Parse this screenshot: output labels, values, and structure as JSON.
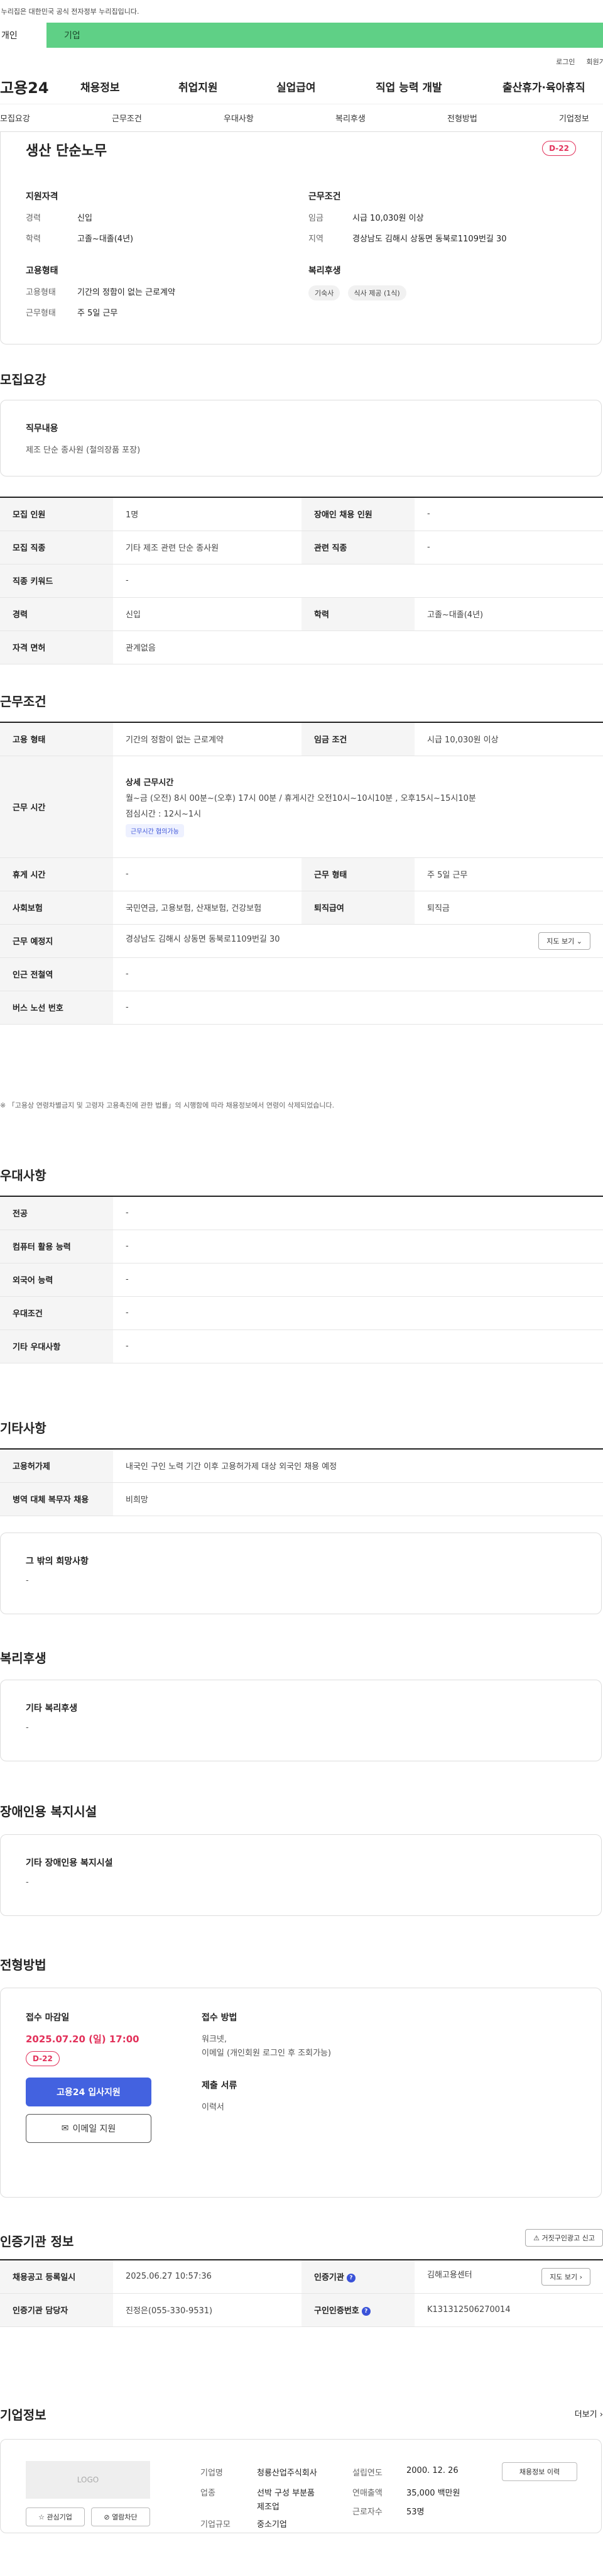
{
  "gov_notice": "이 누리집은 대한민국 공식 전자정부 누리집입니다.",
  "tabs": [
    "개인",
    "기업"
  ],
  "util": [
    "로그인",
    "회원가입"
  ],
  "logo": "고용24",
  "gnb": [
    "채용정보",
    "취업지원",
    "실업급여",
    "직업 능력 개발",
    "출산휴가·육아휴직"
  ],
  "anchor_nav": [
    "모집요강",
    "근무조건",
    "우대사항",
    "복리후생",
    "전형방법",
    "기업정보"
  ],
  "summary": {
    "title": "생산 단순노무",
    "dday": "D-22",
    "qual_title": "지원자격",
    "qual": [
      {
        "k": "경력",
        "v": "신입"
      },
      {
        "k": "학력",
        "v": "고졸~대졸(4년)"
      }
    ],
    "cond_title": "근무조건",
    "cond": [
      {
        "k": "임금",
        "v": "시급 10,030원 이상"
      },
      {
        "k": "지역",
        "v": "경상남도 김해시 상동면 동북로1109번길 30"
      }
    ],
    "emp_title": "고용형태",
    "emp": [
      {
        "k": "고용형태",
        "v": "기간의 정함이 없는 근로계약"
      },
      {
        "k": "근무형태",
        "v": "주 5일 근무"
      }
    ],
    "welfare_title": "복리후생",
    "welfare_chips": [
      "기숙사",
      "식사 제공 (1식)"
    ]
  },
  "recruit": {
    "title": "모집요강",
    "job_box_title": "직무내용",
    "job_box_value": "제조 단순 종사원 (철의장품 포장)",
    "rows": [
      {
        "k1": "모집 인원",
        "v1": "1명",
        "k2": "장애인 채용 인원",
        "v2": "-"
      },
      {
        "k1": "모집 직종",
        "v1": "기타 제조 관련 단순 종사원",
        "k2": "관련 직종",
        "v2": "-"
      },
      {
        "k1": "직종 키워드",
        "v1": "-"
      },
      {
        "k1": "경력",
        "v1": "신입",
        "k2": "학력",
        "v2": "고졸~대졸(4년)"
      },
      {
        "k1": "자격 면허",
        "v1": "관계없음"
      }
    ]
  },
  "work": {
    "title": "근무조건",
    "r1": {
      "k1": "고용 형태",
      "v1": "기간의 정함이 없는 근로계약",
      "k2": "임금 조건",
      "v2": "시급 10,030원 이상"
    },
    "hours": {
      "k": "근무 시간",
      "head": "상세 근무시간",
      "line1": "월~금 (오전) 8시 00분~(오후) 17시 00분 / 휴게시간 오전10시~10시10분 , 오후15시~15시10분",
      "line2": "점심시간 : 12시~1시",
      "tag": "근무시간 협의가능"
    },
    "r3": {
      "k1": "휴게 시간",
      "v1": "-",
      "k2": "근무 형태",
      "v2": "주 5일 근무"
    },
    "r4": {
      "k1": "사회보험",
      "v1": "국민연금, 고용보험, 산재보험, 건강보험",
      "k2": "퇴직급여",
      "v2": "퇴직금"
    },
    "r5": {
      "k1": "근무 예정지",
      "v1": "경상남도 김해시 상동면 동북로1109번길 30",
      "btn": "지도 보기"
    },
    "r6": {
      "k1": "인근 전철역",
      "v1": "-"
    },
    "r7": {
      "k1": "버스 노선 번호",
      "v1": "-"
    },
    "note": "※ 「고용상 연령차별금지 및 고령자 고용촉진에 관한 법률」의 시행함에 따라 채용정보에서 연령이 삭제되었습니다."
  },
  "pref": {
    "title": "우대사항",
    "rows": [
      {
        "k": "전공",
        "v": "-"
      },
      {
        "k": "컴퓨터 활용 능력",
        "v": "-"
      },
      {
        "k": "외국어 능력",
        "v": "-"
      },
      {
        "k": "우대조건",
        "v": "-"
      },
      {
        "k": "기타 우대사항",
        "v": "-"
      }
    ]
  },
  "etc": {
    "title": "기타사항",
    "rows": [
      {
        "k": "고용허가제",
        "v": "내국인 구인 노력 기간 이후 고용허가제 대상 외국인 채용 예정"
      },
      {
        "k": "병역 대체 복무자 채용",
        "v": "비희망"
      }
    ],
    "box_title": "그 밖의 희망사항",
    "box_value": "-"
  },
  "welfare": {
    "title": "복리후생",
    "box_title": "기타 복리후생",
    "box_value": "-"
  },
  "disabled": {
    "title": "장애인용 복지시설",
    "box_title": "기타 장애인용 복지시설",
    "box_value": "-"
  },
  "apply": {
    "title": "전형방법",
    "deadline_label": "접수 마감일",
    "deadline": "2025.07.20 (일) 17:00",
    "dday": "D-22",
    "btn_apply": "고용24 입사지원",
    "btn_email": "이메일 지원",
    "method_label": "접수 방법",
    "method_v1": "워크넷,",
    "method_v2": "이메일 (개인회원 로그인 후 조회가능)",
    "docs_label": "제출 서류",
    "docs_value": "이력서"
  },
  "agency": {
    "title": "인증기관 정보",
    "report_btn": "거짓구인광고 신고",
    "r1": {
      "k1": "채용공고 등록일시",
      "v1": "2025.06.27 10:57:36",
      "k2": "인증기관",
      "v2": "김해고용센터",
      "btn": "지도 보기"
    },
    "r2": {
      "k1": "인증기관 담당자",
      "v1": "진정은(055-330-9531)",
      "k2": "구인인증번호",
      "v2": "K131312506270014"
    }
  },
  "company": {
    "title": "기업정보",
    "more": "더보기",
    "logo_text": "LOGO",
    "btn_interest": "관심기업",
    "btn_block": "열람차단",
    "btn_jobs": "채용정보 이력",
    "k_name": "기업명",
    "v_name": "청룡산업주식회사",
    "k_industry": "업종",
    "v_industry1": "선박 구성 부분품",
    "v_industry2": "제조업",
    "k_size": "기업규모",
    "v_size": "중소기업",
    "k_year": "설립연도",
    "v_year": "2000. 12. 26",
    "k_sales": "연매출액",
    "v_sales": "35,000 백만원",
    "k_emp": "근로자수",
    "v_emp": "53명"
  },
  "colors": {
    "brand_green": "#5fd086",
    "dday_red": "#e2315a",
    "primary_blue": "#4362e0"
  }
}
